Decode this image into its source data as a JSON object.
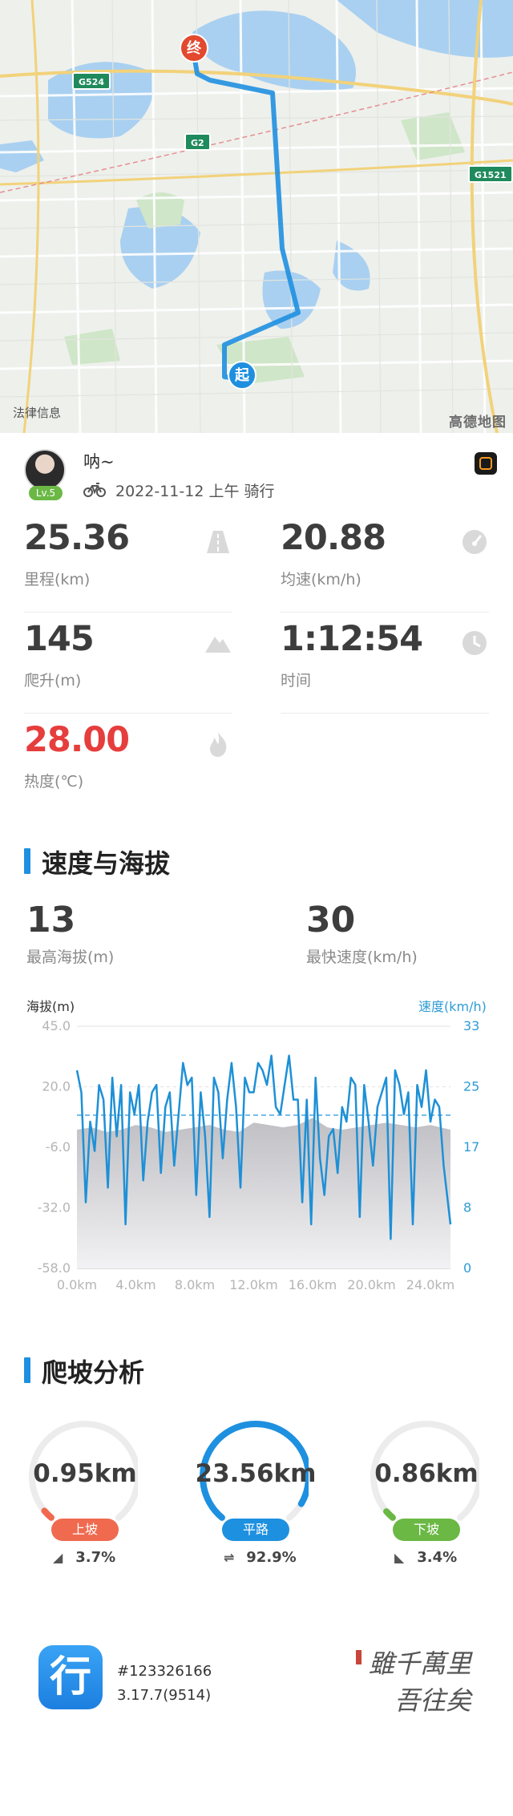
{
  "map": {
    "legal_text": "法律信息",
    "brand": "高德地图",
    "road_signs": [
      "G524",
      "G2",
      "G1521"
    ],
    "end_pin": "终",
    "start_pin": "起",
    "route_color": "#1f8fe0"
  },
  "profile": {
    "username": "呐~",
    "level": "Lv.5",
    "activity": "2022-11-12 上午 骑行"
  },
  "stats": [
    {
      "value": "25.36",
      "label": "里程(km)",
      "icon": "road-icon"
    },
    {
      "value": "20.88",
      "label": "均速(km/h)",
      "icon": "speedometer-icon"
    },
    {
      "value": "145",
      "label": "爬升(m)",
      "icon": "mountain-icon"
    },
    {
      "value": "1:12:54",
      "label": "时间",
      "icon": "clock-icon"
    },
    {
      "value": "28.00",
      "label": "热度(℃)",
      "icon": "flame-icon"
    }
  ],
  "speed_section": {
    "title": "速度与海拔",
    "max_altitude": {
      "value": "13",
      "label": "最高海拔(m)"
    },
    "max_speed": {
      "value": "30",
      "label": "最快速度(km/h)"
    },
    "y_left_title": "海拔(m)",
    "y_right_title": "速度(km/h)"
  },
  "chart_data": {
    "type": "line",
    "x_label_ticks": [
      "0.0km",
      "4.0km",
      "8.0km",
      "12.0km",
      "16.0km",
      "20.0km",
      "24.0km"
    ],
    "y_left_ticks": [
      "45.0",
      "20.0",
      "-6.0",
      "-32.0",
      "-58.0"
    ],
    "y_right_ticks": [
      "33",
      "25",
      "17",
      "8",
      "0"
    ],
    "x_range_km": [
      0,
      25.36
    ],
    "altitude_range_m": [
      -58,
      45
    ],
    "speed_range_kmh": [
      0,
      33
    ],
    "average_speed_line_kmh": 20.88,
    "series": [
      {
        "name": "速度",
        "color": "#1e90d6",
        "x_km": [
          0,
          0.3,
          0.6,
          0.9,
          1.2,
          1.5,
          1.8,
          2.1,
          2.4,
          2.7,
          3.0,
          3.3,
          3.6,
          3.9,
          4.2,
          4.5,
          4.8,
          5.1,
          5.4,
          5.7,
          6.0,
          6.3,
          6.6,
          6.9,
          7.2,
          7.5,
          7.8,
          8.1,
          8.4,
          8.7,
          9.0,
          9.3,
          9.6,
          9.9,
          10.2,
          10.5,
          10.8,
          11.1,
          11.4,
          11.7,
          12.0,
          12.3,
          12.6,
          12.9,
          13.2,
          13.5,
          13.8,
          14.1,
          14.4,
          14.7,
          15.0,
          15.3,
          15.6,
          15.9,
          16.2,
          16.5,
          16.8,
          17.1,
          17.4,
          17.7,
          18.0,
          18.3,
          18.6,
          18.9,
          19.2,
          19.5,
          19.8,
          20.1,
          20.4,
          20.7,
          21.0,
          21.3,
          21.6,
          21.9,
          22.2,
          22.5,
          22.8,
          23.1,
          23.4,
          23.7,
          24.0,
          24.3,
          24.6,
          24.9,
          25.36
        ],
        "values": [
          27,
          24,
          9,
          20,
          16,
          25,
          23,
          11,
          26,
          18,
          25,
          6,
          24,
          21,
          25,
          12,
          20,
          24,
          25,
          13,
          22,
          24,
          14,
          21,
          28,
          25,
          26,
          10,
          24,
          18,
          7,
          26,
          24,
          15,
          23,
          28,
          22,
          11,
          26,
          24,
          24,
          28,
          27,
          25,
          29,
          22,
          21,
          25,
          29,
          23,
          23,
          9,
          23,
          6,
          26,
          15,
          10,
          18,
          19,
          13,
          22,
          20,
          26,
          25,
          7,
          25,
          20,
          14,
          22,
          24,
          26,
          4,
          27,
          25,
          21,
          24,
          6,
          25,
          22,
          27,
          20,
          23,
          22,
          14,
          6
        ]
      },
      {
        "name": "海拔",
        "color": "#c9c9cc",
        "x_km": [
          0,
          1,
          2,
          3,
          4,
          5,
          6,
          7,
          8,
          9,
          10,
          11,
          12,
          13,
          14,
          15,
          16,
          17,
          18,
          19,
          20,
          21,
          22,
          23,
          24,
          25.36
        ],
        "values": [
          1,
          2,
          0,
          1,
          3,
          2,
          0,
          1,
          2,
          3,
          1,
          0,
          4,
          3,
          2,
          3,
          6,
          2,
          1,
          2,
          3,
          4,
          3,
          2,
          3,
          1
        ]
      }
    ]
  },
  "climb_section": {
    "title": "爬坡分析",
    "items": [
      {
        "value": "0.95km",
        "tag": "上坡",
        "percent": "3.7%",
        "color": "#f06a4f",
        "fraction": 0.037,
        "icon": "uphill-icon"
      },
      {
        "value": "23.56km",
        "tag": "平路",
        "percent": "92.9%",
        "color": "#1e90e0",
        "fraction": 0.929,
        "icon": "flat-road-icon"
      },
      {
        "value": "0.86km",
        "tag": "下坡",
        "percent": "3.4%",
        "color": "#6bb845",
        "fraction": 0.034,
        "icon": "downhill-icon"
      }
    ]
  },
  "footer": {
    "app_glyph": "行",
    "record_id": "#123326166",
    "version": "3.17.7(9514)",
    "calligraphy": [
      "雖千萬里",
      "吾往矣"
    ]
  }
}
